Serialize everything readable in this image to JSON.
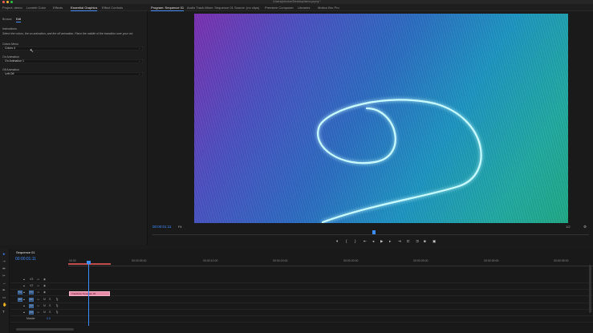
{
  "window": {
    "title": "/Users/johndoe/Desktop/demo.prproj *"
  },
  "source_tabs": [
    {
      "label": "Project: demo",
      "active": false
    },
    {
      "label": "Lumetri Color",
      "active": false
    },
    {
      "label": "Effects",
      "active": false
    },
    {
      "label": "Essential Graphics",
      "active": true
    },
    {
      "label": "Effect Controls",
      "active": false
    }
  ],
  "essential_graphics": {
    "subtabs": [
      {
        "label": "Browse",
        "active": false
      },
      {
        "label": "Edit",
        "active": true
      }
    ],
    "instructions_label": "Instructions",
    "instructions_text": "Select the colors, the on animation, and the off animation. Place the middle of the transition over your cut.",
    "colors_label": "Colors Menu",
    "colors_value": "Colors 4",
    "on_label": "On Animation",
    "on_value": "On Animation 1",
    "off_label": "Off Animation",
    "off_value": "Left Off"
  },
  "program_tabs": [
    {
      "label": "Program: Sequence 01",
      "active": true
    },
    {
      "label": "Audio Track Mixer: Sequence 01",
      "active": false
    },
    {
      "label": "Source: (no clips)",
      "active": false
    },
    {
      "label": "Premiere Composer",
      "active": false
    },
    {
      "label": "Libraries",
      "active": false
    },
    {
      "label": "Motion Bro Pro",
      "active": false
    }
  ],
  "program": {
    "timecode": "00:00:01:11",
    "fit": "Fit",
    "resolution": "1/2",
    "controls": [
      "marker-icon",
      "in-icon",
      "out-icon",
      "go-to-in-icon",
      "step-back-icon",
      "play-icon",
      "step-forward-icon",
      "go-to-out-icon",
      "insert-icon",
      "overwrite-icon",
      "export-frame-icon",
      "compare-icon"
    ]
  },
  "timeline": {
    "tab_label": "Sequence 01",
    "timecode": "00:00:01:11",
    "ruler": [
      "00:00",
      "00:00:05:00",
      "00:00:10:00",
      "00:00:15:00",
      "00:00:20:00",
      "00:00:25:00",
      "00:00:30:00",
      "00:00:35:00"
    ],
    "video_tracks": [
      "V3",
      "V2",
      "V1"
    ],
    "audio_tracks": [
      "A1",
      "A2",
      "A3"
    ],
    "master_label": "Master",
    "master_value": "0.0",
    "clip_label": "Transition Template 03"
  },
  "colors": {
    "accent": "#3d8dff",
    "clip": "#e78aa8",
    "work_area": "#c24b4b"
  }
}
